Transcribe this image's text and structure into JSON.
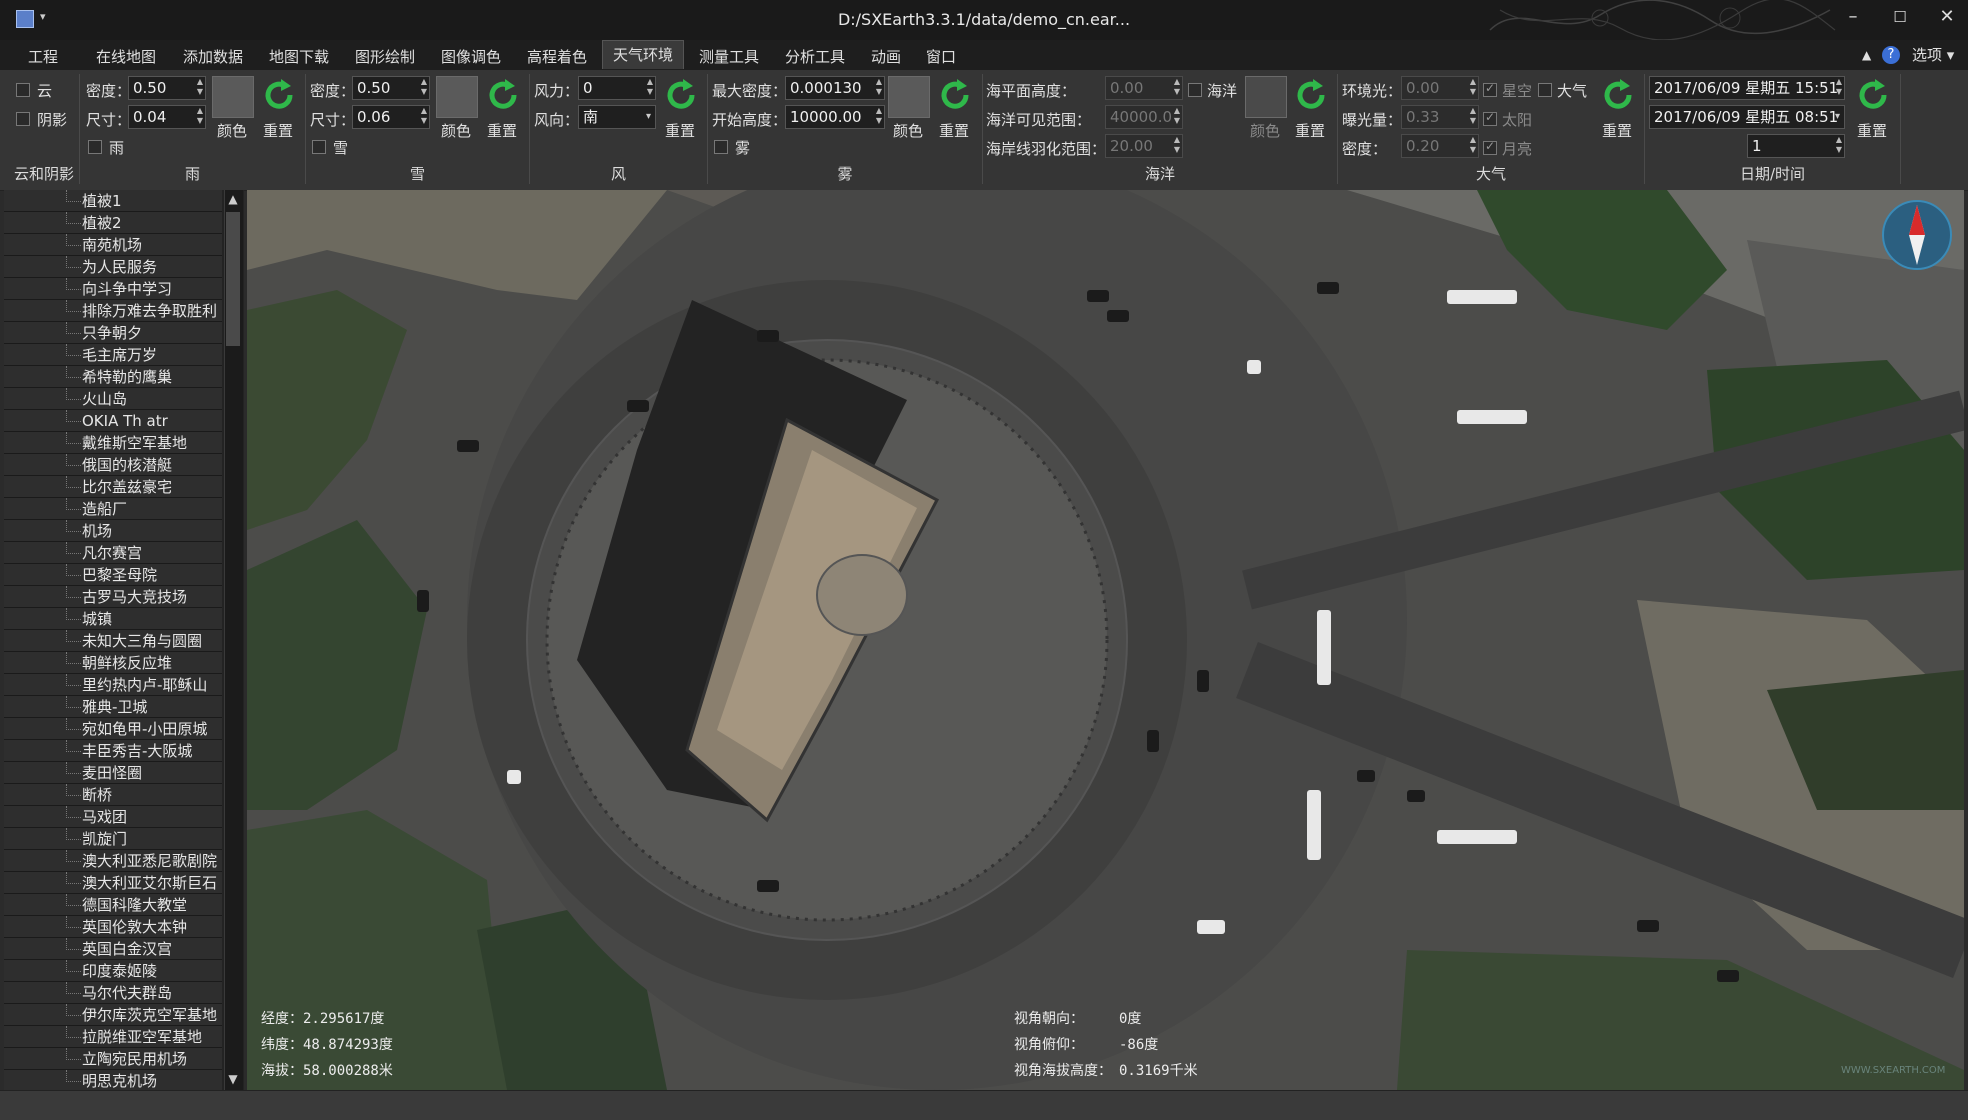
{
  "titlebar": {
    "title": "D:/SXEarth3.3.1/data/demo_cn.ear...",
    "qa": "▾",
    "min": "–",
    "max": "☐",
    "close": "✕"
  },
  "menubar": {
    "items": [
      "工程",
      "在线地图",
      "添加数据",
      "地图下载",
      "图形绘制",
      "图像调色",
      "高程着色",
      "天气环境",
      "测量工具",
      "分析工具",
      "动画",
      "窗口"
    ],
    "active": "天气环境",
    "options_label": "选项",
    "help_icon": "?"
  },
  "ribbon": {
    "cloud": {
      "cloud_label": "云",
      "shadow_label": "阴影",
      "group": "云和阴影"
    },
    "rain": {
      "density_label": "密度：",
      "density": "0.50",
      "size_label": "尺寸：",
      "size": "0.04",
      "color_label": "颜色",
      "reset_label": "重置",
      "rain_label": "雨",
      "group": "雨"
    },
    "snow": {
      "density_label": "密度：",
      "density": "0.50",
      "size_label": "尺寸：",
      "size": "0.06",
      "color_label": "颜色",
      "reset_label": "重置",
      "snow_label": "雪",
      "group": "雪"
    },
    "wind": {
      "force_label": "风力：",
      "force": "0",
      "dir_label": "风向：",
      "dir": "南",
      "reset_label": "重置",
      "group": "风"
    },
    "fog": {
      "max_label": "最大密度：",
      "max": "0.000130",
      "start_label": "开始高度：",
      "start": "10000.00",
      "color_label": "颜色",
      "reset_label": "重置",
      "fog_label": "雾",
      "group": "雾"
    },
    "ocean": {
      "level_label": "海平面高度：",
      "level": "0.00",
      "vis_label": "海洋可见范围：",
      "vis": "40000.0",
      "feather_label": "海岸线羽化范围：",
      "feather": "20.00",
      "ocean_label": "海洋",
      "color_label": "颜色",
      "reset_label": "重置",
      "group": "海洋"
    },
    "atmosphere": {
      "ambient_label": "环境光：",
      "ambient": "0.00",
      "exposure_label": "曝光量：",
      "exposure": "0.33",
      "density_label": "密度：",
      "density": "0.20",
      "sky_label": "星空",
      "sun_label": "太阳",
      "moon_label": "月亮",
      "atm_label": "大气",
      "reset_label": "重置",
      "group": "大气"
    },
    "datetime": {
      "dt1": "2017/06/09 星期五 15:51",
      "dt2": "2017/06/09 星期五 08:51",
      "step": "1",
      "reset_label": "重置",
      "group": "日期/时间"
    }
  },
  "sidebar": {
    "items": [
      "植被1",
      "植被2",
      "南苑机场",
      "为人民服务",
      "向斗争中学习",
      "排除万难去争取胜利",
      "只争朝夕",
      "毛主席万岁",
      "希特勒的鹰巢",
      "火山岛",
      "OKIA Th atr",
      "戴维斯空军基地",
      "俄国的核潜艇",
      "比尔盖兹豪宅",
      "造船厂",
      "机场",
      "凡尔赛宫",
      "巴黎圣母院",
      "古罗马大竞技场",
      "城镇",
      "未知大三角与圆圈",
      "朝鲜核反应堆",
      "里约热内卢-耶稣山",
      "雅典-卫城",
      "宛如龟甲-小田原城",
      "丰臣秀吉-大阪城",
      "麦田怪圈",
      "断桥",
      "马戏团",
      "凯旋门",
      "澳大利亚悉尼歌剧院",
      "澳大利亚艾尔斯巨石",
      "德国科隆大教堂",
      "英国伦敦大本钟",
      "英国白金汉宫",
      "印度泰姬陵",
      "马尔代夫群岛",
      "伊尔库茨克空军基地",
      "拉脱维亚空军基地",
      "立陶宛民用机场",
      "明思克机场"
    ]
  },
  "map": {
    "lon": "经度：2.295617度",
    "lat": "纬度：48.874293度",
    "alt": "海拔：58.000288米",
    "heading_label": "视角朝向：",
    "heading": "0度",
    "pitch_label": "视角俯仰：",
    "pitch": "-86度",
    "height_label": "视角海拔高度：",
    "height": "0.3169千米",
    "watermark": "WWW.SXEARTH.COM"
  },
  "colors": {
    "accent_green": "#2fb84a",
    "panel": "#353535",
    "titlebar": "#1a1a1a"
  }
}
